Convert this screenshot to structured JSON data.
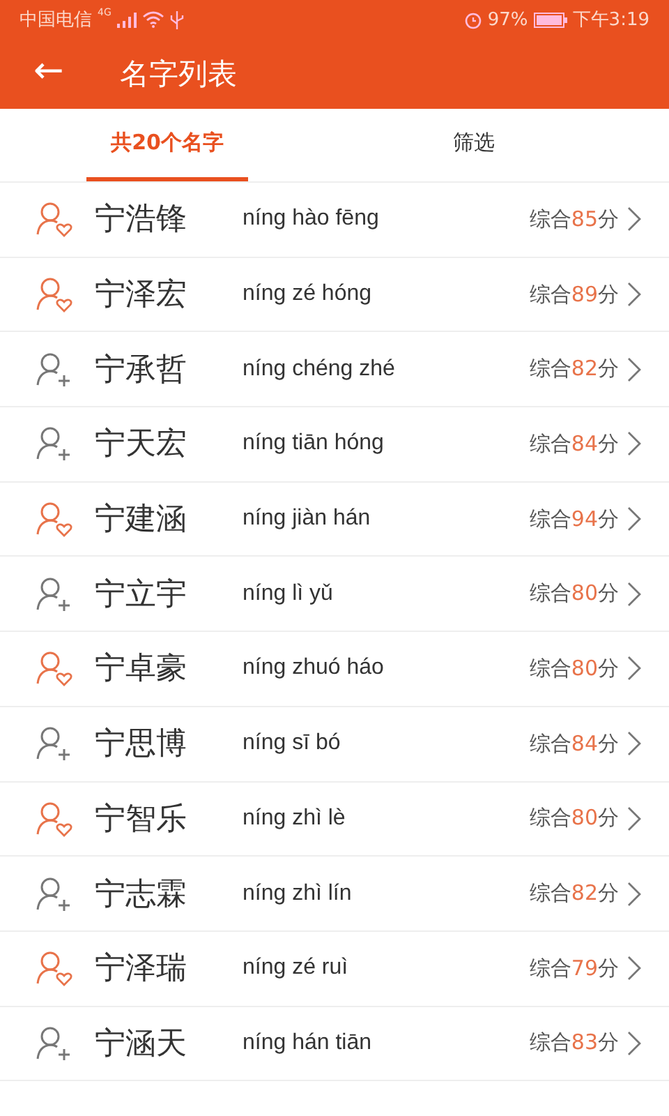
{
  "status_bar": {
    "carrier": "中国电信",
    "network": "4G",
    "battery": "97%",
    "time": "下午3:19"
  },
  "header": {
    "back": "←",
    "title": "名字列表"
  },
  "tabs": [
    {
      "label": "共20个名字",
      "selected": true
    },
    {
      "label": "筛选",
      "selected": false
    }
  ],
  "names": [
    {
      "kind": "favorite",
      "name": "宁浩锋",
      "pinyin": "níng hào fēng",
      "score_prefix": "综合",
      "score": "85",
      "score_suffix": "分"
    },
    {
      "kind": "favorite",
      "name": "宁泽宏",
      "pinyin": "níng zé hóng",
      "score_prefix": "综合",
      "score": "89",
      "score_suffix": "分"
    },
    {
      "kind": "add",
      "name": "宁承哲",
      "pinyin": "níng chéng zhé",
      "score_prefix": "综合",
      "score": "82",
      "score_suffix": "分"
    },
    {
      "kind": "add",
      "name": "宁天宏",
      "pinyin": "níng tiān hóng",
      "score_prefix": "综合",
      "score": "84",
      "score_suffix": "分"
    },
    {
      "kind": "favorite",
      "name": "宁建涵",
      "pinyin": "níng jiàn hán",
      "score_prefix": "综合",
      "score": "94",
      "score_suffix": "分"
    },
    {
      "kind": "add",
      "name": "宁立宇",
      "pinyin": "níng lì yǔ",
      "score_prefix": "综合",
      "score": "80",
      "score_suffix": "分"
    },
    {
      "kind": "favorite",
      "name": "宁卓豪",
      "pinyin": "níng zhuó háo",
      "score_prefix": "综合",
      "score": "80",
      "score_suffix": "分"
    },
    {
      "kind": "add",
      "name": "宁思博",
      "pinyin": "níng sī bó",
      "score_prefix": "综合",
      "score": "84",
      "score_suffix": "分"
    },
    {
      "kind": "favorite",
      "name": "宁智乐",
      "pinyin": "níng zhì lè",
      "score_prefix": "综合",
      "score": "80",
      "score_suffix": "分"
    },
    {
      "kind": "add",
      "name": "宁志霖",
      "pinyin": "níng zhì lín",
      "score_prefix": "综合",
      "score": "82",
      "score_suffix": "分"
    },
    {
      "kind": "favorite",
      "name": "宁泽瑞",
      "pinyin": "níng zé ruì",
      "score_prefix": "综合",
      "score": "79",
      "score_suffix": "分"
    },
    {
      "kind": "add",
      "name": "宁涵天",
      "pinyin": "níng hán tiān",
      "score_prefix": "综合",
      "score": "83",
      "score_suffix": "分"
    }
  ]
}
